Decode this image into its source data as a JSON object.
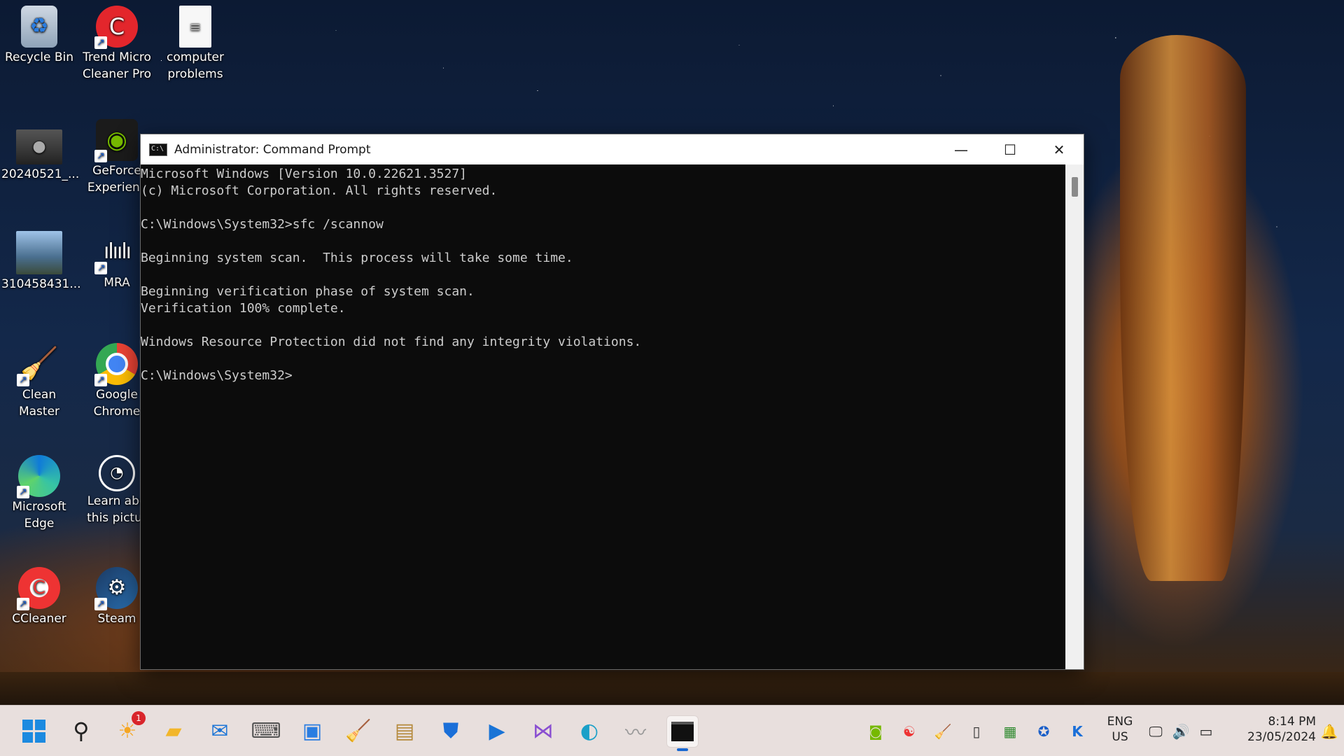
{
  "desktop": {
    "icons": [
      {
        "label": "Recycle Bin"
      },
      {
        "label": "Trend Micro\nCleaner Pro"
      },
      {
        "label": "computer\nproblems"
      },
      {
        "label": "20240521_..."
      },
      {
        "label": "GeForce\nExperienc"
      },
      {
        "label": "310458431..."
      },
      {
        "label": "MRA"
      },
      {
        "label": "Clean Master"
      },
      {
        "label": "Google\nChrome"
      },
      {
        "label": "Microsoft\nEdge"
      },
      {
        "label": "Learn abo\nthis pictur"
      },
      {
        "label": "CCleaner"
      },
      {
        "label": "Steam"
      }
    ]
  },
  "window": {
    "title": "Administrator: Command Prompt",
    "minimize_glyph": "—",
    "maximize_glyph": "☐",
    "close_glyph": "✕",
    "console_text": "Microsoft Windows [Version 10.0.22621.3527]\n(c) Microsoft Corporation. All rights reserved.\n\nC:\\Windows\\System32>sfc /scannow\n\nBeginning system scan.  This process will take some time.\n\nBeginning verification phase of system scan.\nVerification 100% complete.\n\nWindows Resource Protection did not find any integrity violations.\n\nC:\\Windows\\System32>"
  },
  "taskbar": {
    "weather_badge": "1",
    "language": {
      "line1": "ENG",
      "line2": "US"
    },
    "clock": {
      "time": "8:14 PM",
      "date": "23/05/2024"
    }
  },
  "colors": {
    "console_bg": "#0c0c0c",
    "console_fg": "#cccccc",
    "taskbar_bg": "#e8dfdd",
    "accent": "#1a68d1"
  }
}
